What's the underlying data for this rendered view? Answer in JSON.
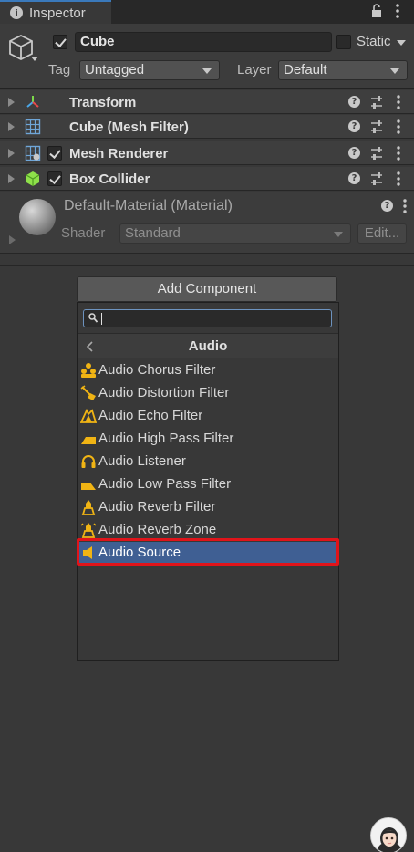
{
  "tab": {
    "title": "Inspector"
  },
  "header": {
    "name": "Cube",
    "static_label": "Static",
    "tag_label": "Tag",
    "tag_value": "Untagged",
    "layer_label": "Layer",
    "layer_value": "Default"
  },
  "components": [
    {
      "name": "Transform",
      "icon": "transform-icon",
      "has_checkbox": false
    },
    {
      "name": "Cube (Mesh Filter)",
      "icon": "mesh-filter-icon",
      "has_checkbox": false
    },
    {
      "name": "Mesh Renderer",
      "icon": "mesh-renderer-icon",
      "has_checkbox": true,
      "checked": true
    },
    {
      "name": "Box Collider",
      "icon": "box-collider-icon",
      "has_checkbox": true,
      "checked": true
    }
  ],
  "material": {
    "title": "Default-Material (Material)",
    "shader_label": "Shader",
    "shader_value": "Standard",
    "edit_label": "Edit..."
  },
  "add_component": {
    "button_label": "Add Component",
    "search_value": "",
    "category": "Audio",
    "items": [
      {
        "label": "Audio Chorus Filter",
        "icon": "audio-chorus-filter-icon"
      },
      {
        "label": "Audio Distortion Filter",
        "icon": "audio-distortion-filter-icon"
      },
      {
        "label": "Audio Echo Filter",
        "icon": "audio-echo-filter-icon"
      },
      {
        "label": "Audio High Pass Filter",
        "icon": "audio-high-pass-filter-icon"
      },
      {
        "label": "Audio Listener",
        "icon": "audio-listener-icon"
      },
      {
        "label": "Audio Low Pass Filter",
        "icon": "audio-low-pass-filter-icon"
      },
      {
        "label": "Audio Reverb Filter",
        "icon": "audio-reverb-filter-icon"
      },
      {
        "label": "Audio Reverb Zone",
        "icon": "audio-reverb-zone-icon"
      },
      {
        "label": "Audio Source",
        "icon": "audio-source-icon",
        "selected": true
      }
    ]
  },
  "colors": {
    "accent": "#3a79bb",
    "selection": "#3f5f93",
    "highlight": "#e0141a",
    "audio_icon": "#f0b414"
  }
}
